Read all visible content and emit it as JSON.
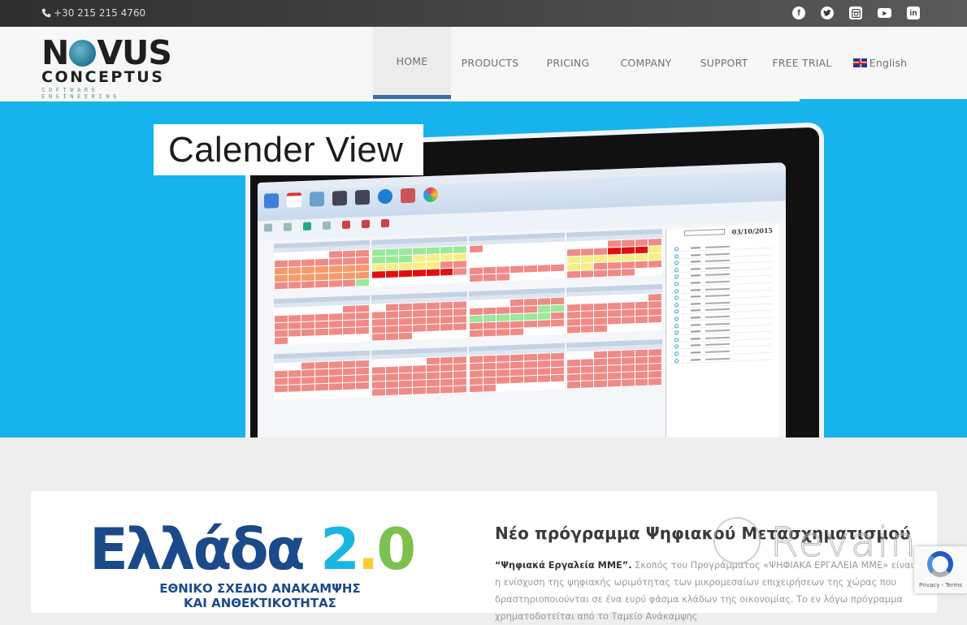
{
  "topbar": {
    "phone": "+30 215 215 4760",
    "social": [
      {
        "name": "facebook-icon",
        "glyph": "f"
      },
      {
        "name": "twitter-icon",
        "glyph": "t"
      },
      {
        "name": "instagram-icon",
        "glyph": "◙"
      },
      {
        "name": "youtube-icon",
        "glyph": "▶"
      },
      {
        "name": "linkedin-icon",
        "glyph": "in"
      }
    ]
  },
  "logo": {
    "line1_left": "N",
    "line1_right": "VUS",
    "line2": "CONCEPTUS",
    "tagline": "SOFTWARE ENGINEERING"
  },
  "nav": {
    "items": [
      {
        "label": "HOME",
        "active": true
      },
      {
        "label": "PRODUCTS",
        "active": false
      },
      {
        "label": "PRICING",
        "active": false
      },
      {
        "label": "COMPANY",
        "active": false
      },
      {
        "label": "SUPPORT",
        "active": false
      },
      {
        "label": "FREE TRIAL",
        "active": false
      }
    ],
    "language": "English"
  },
  "hero": {
    "title": "Calender View",
    "screen_date": "03/10/2015",
    "colors": {
      "background": "#17b3ec",
      "booked": "#f08a86",
      "free": "#9be89a",
      "pending": "#f6ef85",
      "full": "#e01010"
    }
  },
  "card": {
    "logo_word": "Ελλάδα",
    "logo_num_2": "2",
    "logo_dot": ".",
    "logo_num_0": "0",
    "logo_sub_line1": "ΕΘΝΙΚΟ ΣΧΕΔΙΟ ΑΝΑΚΑΜΨΗΣ",
    "logo_sub_line2": "ΚΑΙ ΑΝΘΕΚΤΙΚΟΤΗΤΑΣ",
    "article_title": "Νέο πρόγραμμα Ψηφιακού Μετασχηματισμού",
    "article_lead": "“Ψηφιακά Εργαλεία ΜΜΕ”.",
    "article_body": " Σκοπός του Προγράμματος «ΨΗΦΙΑΚΑ ΕΡΓΑΛΕΙΑ ΜΜΕ» είναι η ενίσχυση της ψηφιακής ωριμότητας των μικρομεσαίων επιχειρήσεων της χώρας που δραστηριοποιούνται σε ένα ευρύ φάσμα κλάδων της οικονομίας. Το εν λόγω πρόγραμμα χρηματοδοτείται από το Ταμείο Ανάκαμψης"
  },
  "watermark": {
    "text": "Revain"
  },
  "recaptcha": {
    "links": "Privacy - Terms"
  }
}
